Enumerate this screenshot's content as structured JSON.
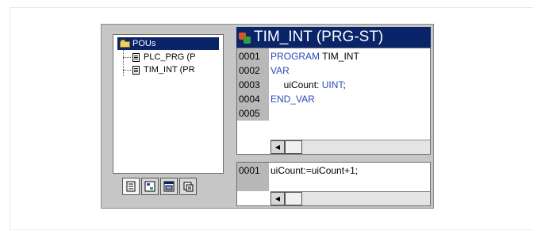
{
  "tree": {
    "root_label": "POUs",
    "items": [
      {
        "label": "PLC_PRG (P"
      },
      {
        "label": "TIM_INT (PR"
      }
    ]
  },
  "toolbar": {
    "buttons": [
      {
        "icon": "pous-tab-icon"
      },
      {
        "icon": "data-types-tab-icon"
      },
      {
        "icon": "visualizations-tab-icon"
      },
      {
        "icon": "resources-tab-icon"
      }
    ]
  },
  "editor": {
    "title": "TIM_INT (PRG-ST)",
    "declaration": {
      "line_numbers": [
        "0001",
        "0002",
        "0003",
        "0004",
        "0005"
      ],
      "lines": [
        {
          "keyword": "PROGRAM",
          "text": " TIM_INT"
        },
        {
          "keyword": "VAR",
          "text": ""
        },
        {
          "keyword": "",
          "text": "     uiCount: ",
          "type": "UINT",
          "end": ";"
        },
        {
          "keyword": "END_VAR",
          "text": ""
        },
        {
          "keyword": "",
          "text": ""
        }
      ]
    },
    "implementation": {
      "line_numbers": [
        "0001"
      ],
      "lines": [
        {
          "text": "uiCount:=uiCount+1;"
        }
      ]
    },
    "scroll_left_arrow": "◀"
  },
  "colors": {
    "title_bg": "#0a246a",
    "keyword": "#2a4ab8",
    "window_bg": "#c6c6c6"
  }
}
